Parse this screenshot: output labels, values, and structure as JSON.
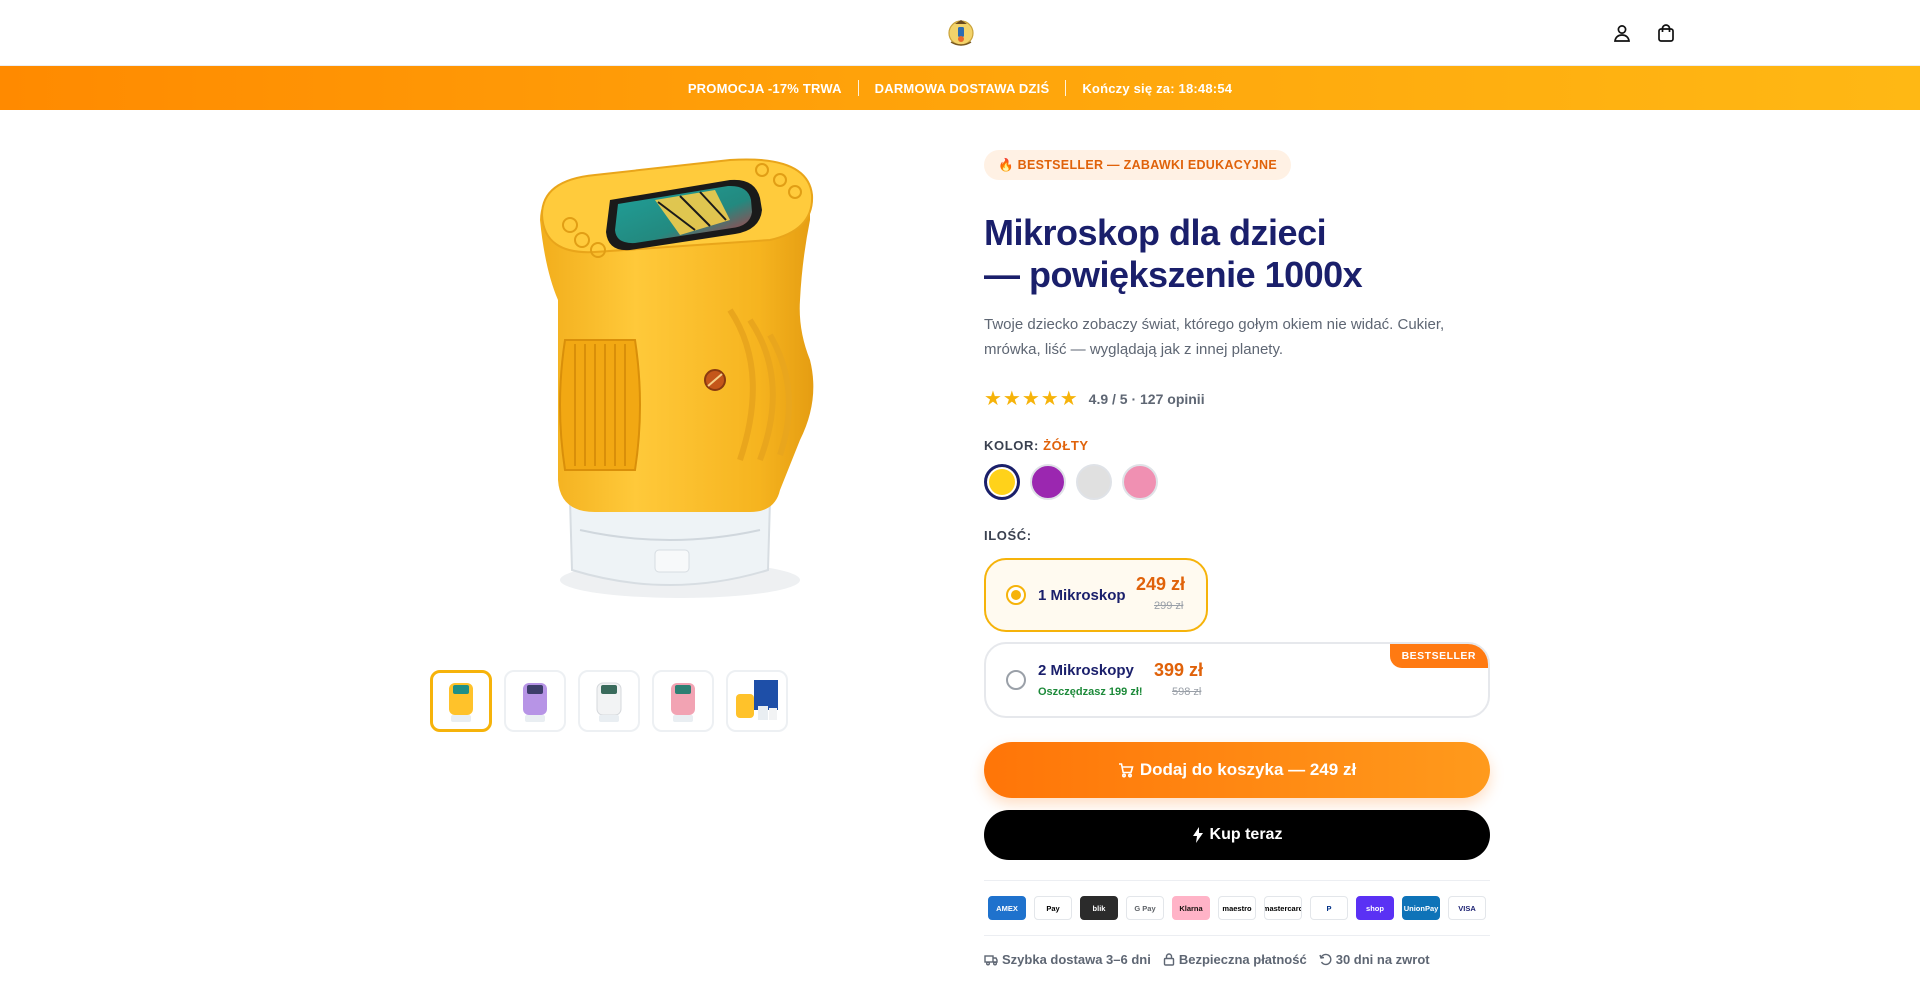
{
  "header": {
    "logo_icon": "microscope-logo-icon",
    "account_icon": "user-icon",
    "cart_icon": "shopping-bag-icon"
  },
  "promo_bar": {
    "promo": "PROMOCJA -17% TRWA",
    "shipping": "DARMOWA DOSTAWA DZIŚ",
    "countdown": "Kończy się za: 18:48:54"
  },
  "gallery": {
    "main_image": "yellow-kids-microscope-with-butterfly-screen",
    "thumbnails": [
      "yellow",
      "purple",
      "white",
      "pink",
      "yellow-with-box"
    ],
    "active_thumbnail": 0
  },
  "product": {
    "badge": "🔥 BESTSELLER — ZABAWKI EDUKACYJNE",
    "title_line1": "Mikroskop dla dzieci",
    "title_line2": "— powiększenie 1000x",
    "description": "Twoje dziecko zobaczy świat, którego gołym okiem nie widać. Cukier, mrówka, liść — wyglądają jak z innej planety.",
    "stars": "★★★★★",
    "rating_text": "4.9 / 5 · 127 opinii",
    "color_label": "KOLOR:",
    "color_value": "ŻÓŁTY",
    "colors": [
      {
        "name": "yellow",
        "hex": "#ffd21a"
      },
      {
        "name": "purple",
        "hex": "#9b27b0"
      },
      {
        "name": "white",
        "hex": "#e0e0e0"
      },
      {
        "name": "pink",
        "hex": "#f090b2"
      }
    ],
    "qty_label": "ILOŚĆ:",
    "options": [
      {
        "name": "1 Mikroskop",
        "price": "249 zł",
        "old_price": "299 zł",
        "selected": true
      },
      {
        "name": "2 Mikroskopy",
        "savings": "Oszczędzasz 199 zł!",
        "price": "399 zł",
        "old_price": "598 zł",
        "ribbon": "BESTSELLER",
        "selected": false
      }
    ],
    "add_to_cart": "Dodaj do koszyka — 249 zł",
    "buy_now": "Kup teraz"
  },
  "payments": [
    {
      "label": "AMEX",
      "bg": "#1f72cd",
      "fg": "#ffffff"
    },
    {
      "label": "Pay",
      "bg": "#ffffff",
      "fg": "#000000"
    },
    {
      "label": "blik",
      "bg": "#2b2b2b",
      "fg": "#ffffff"
    },
    {
      "label": "G Pay",
      "bg": "#ffffff",
      "fg": "#5f6368"
    },
    {
      "label": "Klarna",
      "bg": "#ffb3c7",
      "fg": "#17120f"
    },
    {
      "label": "maestro",
      "bg": "#ffffff",
      "fg": "#000000"
    },
    {
      "label": "mastercard",
      "bg": "#ffffff",
      "fg": "#000000"
    },
    {
      "label": "P",
      "bg": "#ffffff",
      "fg": "#003087"
    },
    {
      "label": "shop",
      "bg": "#5a31f4",
      "fg": "#ffffff"
    },
    {
      "label": "UnionPay",
      "bg": "#0e73b8",
      "fg": "#ffffff"
    },
    {
      "label": "VISA",
      "bg": "#ffffff",
      "fg": "#1a1f71"
    }
  ],
  "perks": [
    {
      "icon": "truck-icon",
      "text": "Szybka dostawa 3–6 dni"
    },
    {
      "icon": "lock-icon",
      "text": "Bezpieczna płatność"
    },
    {
      "icon": "return-icon",
      "text": "30 dni na zwrot"
    }
  ]
}
